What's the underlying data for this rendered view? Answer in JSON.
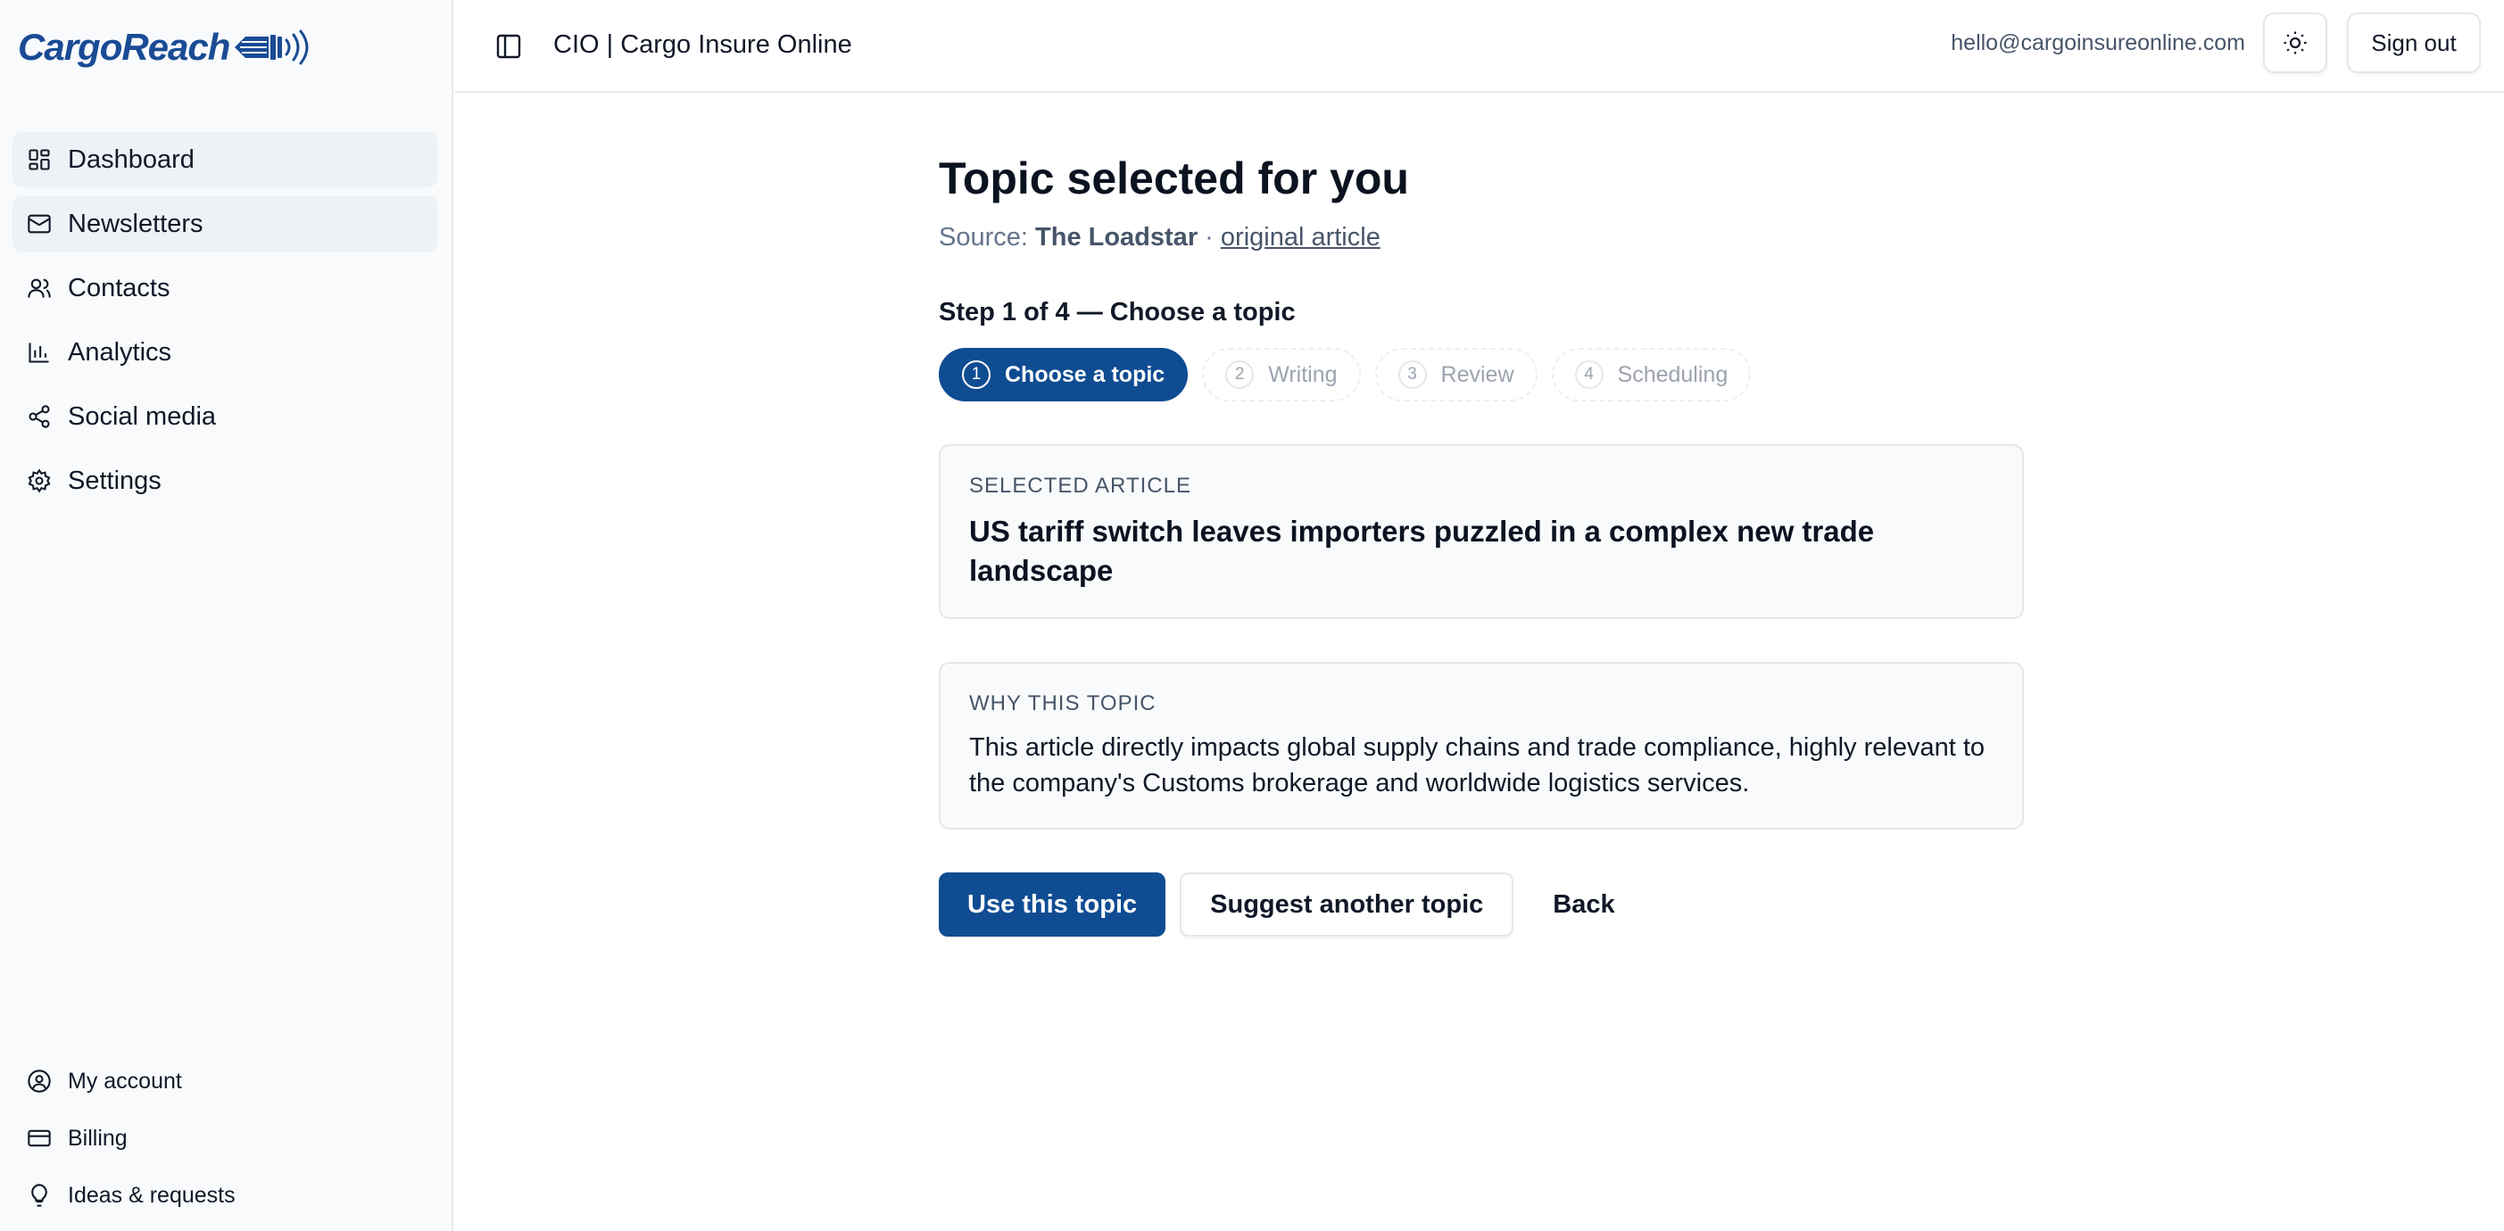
{
  "brand": {
    "name": "CargoReach",
    "color": "#1a4b95"
  },
  "sidebar": {
    "items": [
      {
        "label": "Dashboard",
        "icon": "dashboard-icon",
        "active": true
      },
      {
        "label": "Newsletters",
        "icon": "mail-icon",
        "active": true
      },
      {
        "label": "Contacts",
        "icon": "users-icon",
        "active": false
      },
      {
        "label": "Analytics",
        "icon": "bar-chart-icon",
        "active": false
      },
      {
        "label": "Social media",
        "icon": "share-icon",
        "active": false
      },
      {
        "label": "Settings",
        "icon": "gear-icon",
        "active": false
      }
    ],
    "bottom": [
      {
        "label": "My account",
        "icon": "user-circle-icon"
      },
      {
        "label": "Billing",
        "icon": "credit-card-icon"
      },
      {
        "label": "Ideas & requests",
        "icon": "lightbulb-icon"
      }
    ]
  },
  "header": {
    "title": "CIO | Cargo Insure Online",
    "email": "hello@cargoinsureonline.com",
    "sign_out": "Sign out"
  },
  "main": {
    "title": "Topic selected for you",
    "source_prefix": "Source:",
    "source_name": "The Loadstar",
    "source_sep": "·",
    "source_link": "original article",
    "step_heading": "Step 1 of 4 — Choose a topic",
    "steps": [
      {
        "num": "1",
        "label": "Choose a topic"
      },
      {
        "num": "2",
        "label": "Writing"
      },
      {
        "num": "3",
        "label": "Review"
      },
      {
        "num": "4",
        "label": "Scheduling"
      }
    ],
    "selected_article": {
      "label": "SELECTED ARTICLE",
      "title": "US tariff switch leaves importers puzzled in a complex new trade landscape"
    },
    "why": {
      "label": "WHY THIS TOPIC",
      "body": "This article directly impacts global supply chains and trade compliance, highly relevant to the company's Customs brokerage and worldwide logistics services."
    },
    "actions": {
      "use": "Use this topic",
      "suggest": "Suggest another topic",
      "back": "Back"
    }
  },
  "colors": {
    "primary": "#0f4c92",
    "sidebar_bg": "#f8fafc"
  }
}
